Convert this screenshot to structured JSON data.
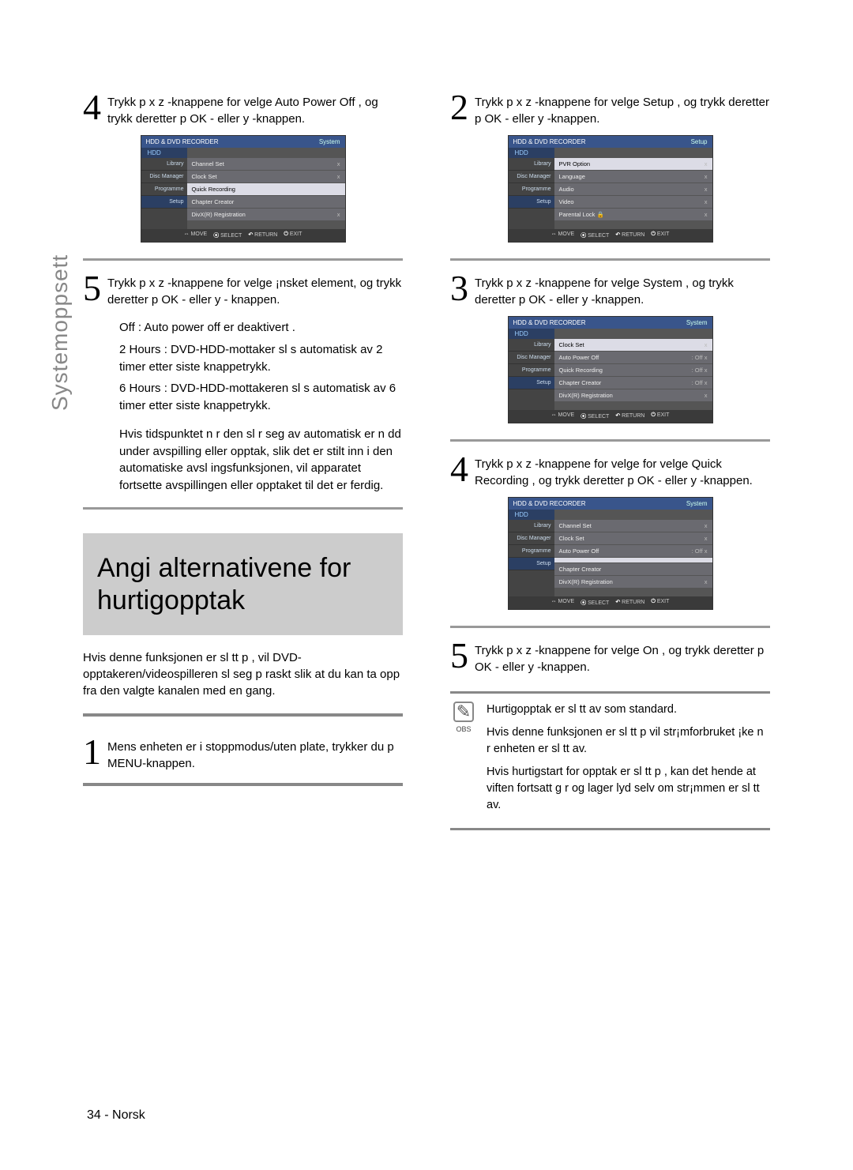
{
  "sidelabel": "Systemoppsett",
  "page_number": "34 - Norsk",
  "left": {
    "step4": "Trykk p    x z  -knappene for   velge  Auto Power Off , og trykk deretter p   OK - eller  y -knappen.",
    "step5": "Trykk p    x z  -knappene for   velge ¡nsket element, og trykk deretter p   OK - eller  y - knappen.",
    "off": "Off  : Auto power off er deaktivert .",
    "h2": "2 Hours  : DVD-HDD-mottaker sl s automatisk av 2 timer etter siste knappetrykk.",
    "h6": "6 Hours  : DVD-HDD-mottakeren sl s automatisk av 6 timer etter siste knappetrykk.",
    "tail": "Hvis tidspunktet n r den sl r seg av automatisk er n dd under avspilling eller opptak, slik det er stilt inn i den automatiske avsl ingsfunksjonen, vil apparatet fortsette avspillingen eller opptaket til det er ferdig.",
    "section_title": "Angi alternativene for hurtigopptak",
    "intro": "Hvis denne funksjonen er sl tt p , vil DVD-opptakeren/videospilleren sl  seg p  raskt slik at du kan ta opp fra den valgte kanalen med en gang.",
    "step1": "Mens enheten er i stoppmodus/uten plate, trykker du p  MENU-knappen."
  },
  "right": {
    "step2": "Trykk p    x z  -knappene for   velge  Setup , og trykk deretter p   OK - eller  y -knappen.",
    "step3": "Trykk p    x z  -knappene for   velge  System , og trykk deretter p   OK - eller  y -knappen.",
    "step4": "Trykk p    x z  -knappene for   velge for   velge Quick Recording  , og trykk deretter p   OK - eller y -knappen.",
    "step5": "Trykk p    x z  -knappene for   velge  On , og trykk deretter p   OK - eller  y -knappen.",
    "note1": "Hurtigopptak er sl tt av som standard.",
    "note2": "Hvis denne funksjonen er sl tt p  vil str¡mforbruket ¡ke n r enheten er sl tt av.",
    "note3": "Hvis hurtigstart for opptak er sl tt p , kan det hende at viften fortsatt g r og lager lyd selv om str¡mmen er sl tt av.",
    "obs": "OBS"
  },
  "osd": {
    "title": "HDD & DVD RECORDER",
    "hdd": "HDD",
    "nav": [
      "Library",
      "Disc Manager",
      "Programme",
      "Setup"
    ],
    "foot": {
      "move": "MOVE",
      "select": "SELECT",
      "return": "RETURN",
      "exit": "EXIT"
    },
    "left4": {
      "right": "System",
      "rows": [
        {
          "l": "Channel Set",
          "r": "x"
        },
        {
          "l": "Clock Set",
          "r": "x"
        },
        {
          "l": "Quick Recording",
          "r": ""
        },
        {
          "l": "Chapter Creator",
          "r": ""
        },
        {
          "l": "DivX(R) Registration",
          "r": "x"
        }
      ],
      "hiIndex": 2
    },
    "r2": {
      "right": "Setup",
      "rows": [
        {
          "l": "PVR Option",
          "r": "x"
        },
        {
          "l": "Language",
          "r": "x"
        },
        {
          "l": "Audio",
          "r": "x"
        },
        {
          "l": "Video",
          "r": "x"
        },
        {
          "l": "Parental Lock  🔒",
          "r": "x"
        }
      ],
      "hiIndex": 0
    },
    "r3": {
      "right": "System",
      "rows": [
        {
          "l": "Clock Set",
          "r": "x"
        },
        {
          "l": "Auto Power Off",
          "r": ": Off      x"
        },
        {
          "l": "Quick Recording",
          "r": ": Off      x"
        },
        {
          "l": "Chapter Creator",
          "r": ": Off      x"
        },
        {
          "l": "DivX(R) Registration",
          "r": "x"
        }
      ],
      "hiIndex": 0
    },
    "r4": {
      "right": "System",
      "rows": [
        {
          "l": "Channel Set",
          "r": "x"
        },
        {
          "l": "Clock Set",
          "r": "x"
        },
        {
          "l": "Auto Power Off",
          "r": ": Off      x"
        },
        {
          "l": "",
          "r": ""
        },
        {
          "l": "Chapter Creator",
          "r": ""
        },
        {
          "l": "DivX(R) Registration",
          "r": "x"
        }
      ],
      "hiIndex": 3
    }
  },
  "nums": {
    "n1": "1",
    "n2": "2",
    "n3": "3",
    "n4": "4",
    "n5": "5"
  }
}
